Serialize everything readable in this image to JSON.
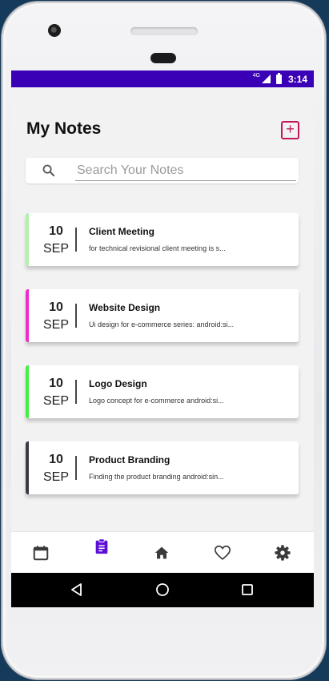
{
  "status_bar": {
    "network": "4G",
    "time": "3:14"
  },
  "header": {
    "title": "My Notes",
    "add_icon": "add-note-icon"
  },
  "search": {
    "placeholder": "Search Your Notes",
    "value": ""
  },
  "notes": [
    {
      "day": "10",
      "month": "SEP",
      "title": "Client Meeting",
      "body": "for technical revisional client meeting is s...",
      "accent": "#b2f0b0"
    },
    {
      "day": "10",
      "month": "SEP",
      "title": "Website Design",
      "body": "Ui design for e-commerce series: android:si...",
      "accent": "#ee2bd0"
    },
    {
      "day": "10",
      "month": "SEP",
      "title": "Logo Design",
      "body": "Logo concept for e-commerce  android:si...",
      "accent": "#44ee44"
    },
    {
      "day": "10",
      "month": "SEP",
      "title": "Product Branding",
      "body": "Finding the product branding    android:sin...",
      "accent": "#3b3b46"
    }
  ],
  "bottom_nav": {
    "items": [
      {
        "icon": "calendar-icon",
        "active": false
      },
      {
        "icon": "clipboard-notes-icon",
        "active": true
      },
      {
        "icon": "home-icon",
        "active": false
      },
      {
        "icon": "heart-icon",
        "active": false
      },
      {
        "icon": "settings-gear-icon",
        "active": false
      }
    ]
  },
  "system_nav": {
    "items": [
      "back-icon",
      "home-circle-icon",
      "recents-icon"
    ]
  },
  "colors": {
    "status_bar": "#3a00b5",
    "active_nav": "#5b0fd8",
    "add_button": "#c2185b"
  }
}
